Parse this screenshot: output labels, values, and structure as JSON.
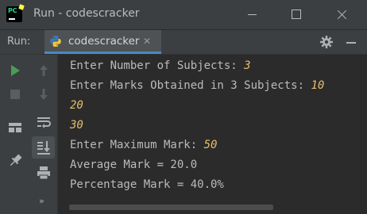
{
  "window": {
    "app_icon_text": "PC",
    "title": "Run - codescracker"
  },
  "run_panel": {
    "label": "Run:",
    "tab_label": "codescracker"
  },
  "console": {
    "lines": [
      {
        "text": "Enter Number of Subjects: ",
        "input": "3"
      },
      {
        "text": "Enter Marks Obtained in 3 Subjects: ",
        "input": "10"
      },
      {
        "text": "",
        "input": "20"
      },
      {
        "text": "",
        "input": "30"
      },
      {
        "text": "Enter Maximum Mark: ",
        "input": "50"
      },
      {
        "text": "Average Mark = 20.0",
        "input": ""
      },
      {
        "text": "Percentage Mark = 40.0%",
        "input": ""
      }
    ]
  },
  "colors": {
    "background": "#2b2b2b",
    "chrome": "#3c3f41",
    "console_text": "#bbbbbb",
    "user_input": "#e8bf6a",
    "run_green": "#499c54",
    "tab_underline": "#4a88c7"
  },
  "icons": {
    "title": [
      "pycharm-logo-icon",
      "minimize-window-icon",
      "maximize-window-icon",
      "close-window-icon"
    ],
    "panel": [
      "python-file-icon",
      "close-tab-icon",
      "settings-gear-icon",
      "hide-panel-icon"
    ],
    "toolbar_left": [
      "rerun-icon",
      "stop-icon",
      "layout-icon",
      "pin-tab-icon",
      "more-icon"
    ],
    "toolbar_right": [
      "up-arrow-icon",
      "down-arrow-icon",
      "soft-wrap-icon",
      "scroll-to-end-icon",
      "print-icon"
    ]
  }
}
